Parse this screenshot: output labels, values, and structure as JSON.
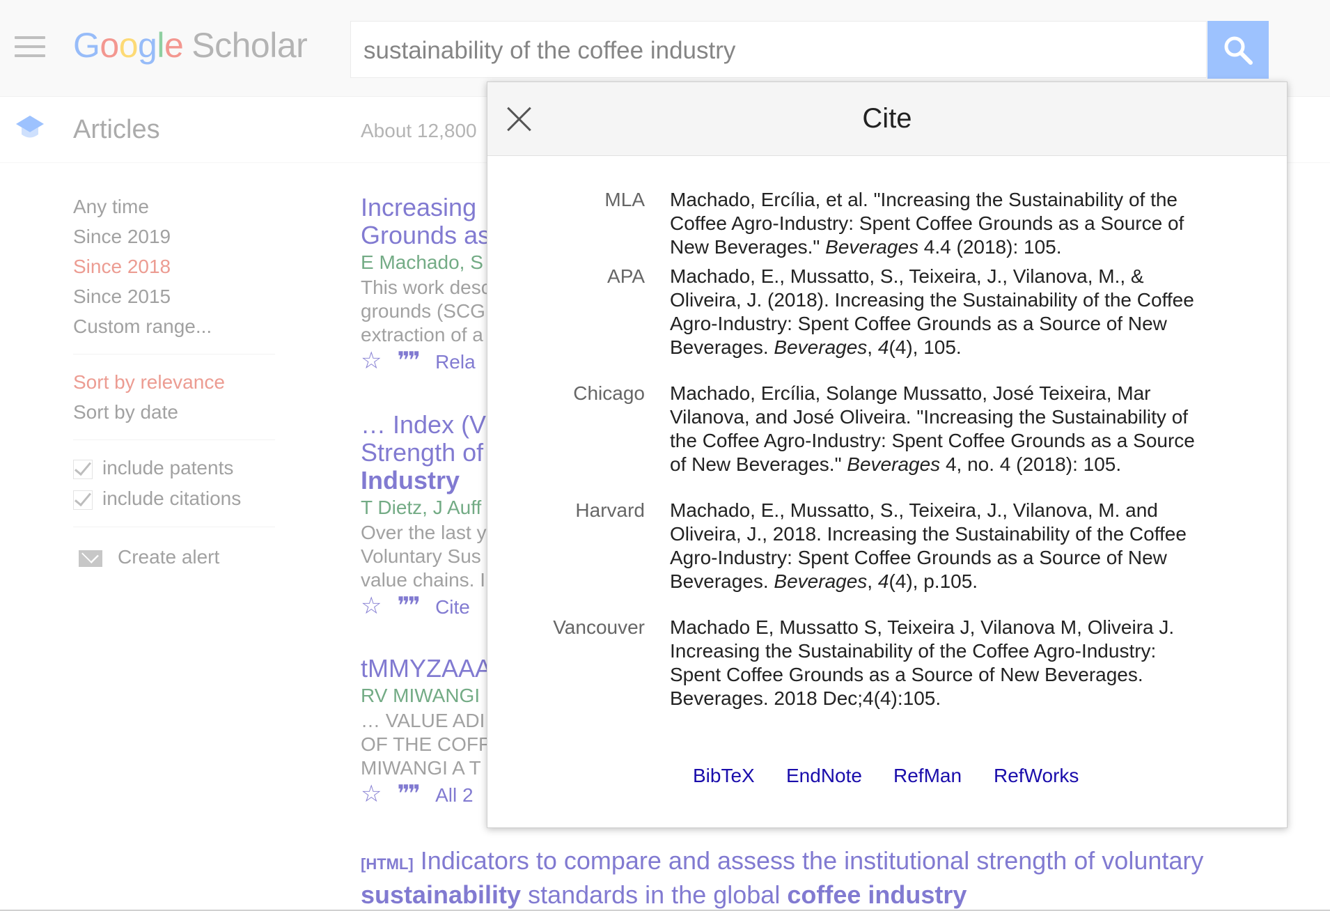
{
  "header": {
    "logo_google": "Google",
    "logo_scholar": "Scholar",
    "search_query": "sustainability of the coffee industry"
  },
  "subbar": {
    "articles_label": "Articles",
    "about_text": "About 12,800"
  },
  "sidebar": {
    "time_filters": [
      "Any time",
      "Since 2019",
      "Since 2018",
      "Since 2015",
      "Custom range..."
    ],
    "selected_time": "Since 2018",
    "sort_options": [
      "Sort by relevance",
      "Sort by date"
    ],
    "selected_sort": "Sort by relevance",
    "include_patents": "include patents",
    "include_citations": "include citations",
    "create_alert": "Create alert"
  },
  "results": [
    {
      "title_lines": [
        "Increasing",
        "Grounds as"
      ],
      "authors": "E Machado, S",
      "snippet_lines": [
        "This work desc",
        "grounds (SCG",
        "extraction of a"
      ],
      "action_link": "Rela"
    },
    {
      "title_lines": [
        "… Index (V",
        "Strength of",
        "Industry"
      ],
      "authors": "T Dietz, J Auff",
      "snippet_lines": [
        "Over the last y",
        "Voluntary Sus",
        "value chains. I"
      ],
      "action_link": "Cite"
    },
    {
      "title_lines": [
        "tMMYZAAA"
      ],
      "authors": "RV MIWANGI",
      "snippet_lines": [
        "… VALUE ADI",
        "OF THE COFF",
        "MIWANGI A T"
      ],
      "action_link": "All 2"
    }
  ],
  "last_result": {
    "tag": "[HTML]",
    "title_part1": "Indicators to compare and assess the institutional strength of voluntary",
    "title_bold1": "sustainability",
    "title_part2": " standards in the global ",
    "title_bold2": "coffee industry"
  },
  "cite_modal": {
    "title": "Cite",
    "citations": [
      {
        "style": "MLA",
        "lines": [
          {
            "pre": "Machado, Ercília, et al. \"Increasing the Sustainability of the",
            "it": "",
            "post": ""
          },
          {
            "pre": "Coffee Agro-Industry: Spent Coffee Grounds as a Source of",
            "it": "",
            "post": ""
          },
          {
            "pre": "New Beverages.\" ",
            "it": "Beverages",
            "post": " 4.4 (2018): 105."
          }
        ]
      },
      {
        "style": "APA",
        "lines": [
          {
            "pre": "Machado, E., Mussatto, S., Teixeira, J., Vilanova, M., &",
            "it": "",
            "post": ""
          },
          {
            "pre": "Oliveira, J. (2018). Increasing the Sustainability of the Coffee",
            "it": "",
            "post": ""
          },
          {
            "pre": "Agro-Industry: Spent Coffee Grounds as a Source of New",
            "it": "",
            "post": ""
          },
          {
            "pre": "Beverages. ",
            "it": "Beverages",
            "post": ", ",
            "it2": "4",
            "post2": "(4), 105."
          }
        ]
      },
      {
        "style": "Chicago",
        "lines": [
          {
            "pre": "Machado, Ercília, Solange Mussatto, José Teixeira, Mar",
            "it": "",
            "post": ""
          },
          {
            "pre": "Vilanova, and José Oliveira. \"Increasing the Sustainability of",
            "it": "",
            "post": ""
          },
          {
            "pre": "the Coffee Agro-Industry: Spent Coffee Grounds as a Source",
            "it": "",
            "post": ""
          },
          {
            "pre": "of New Beverages.\" ",
            "it": "Beverages",
            "post": " 4, no. 4 (2018): 105."
          }
        ]
      },
      {
        "style": "Harvard",
        "lines": [
          {
            "pre": "Machado, E., Mussatto, S., Teixeira, J., Vilanova, M. and",
            "it": "",
            "post": ""
          },
          {
            "pre": "Oliveira, J., 2018. Increasing the Sustainability of the Coffee",
            "it": "",
            "post": ""
          },
          {
            "pre": "Agro-Industry: Spent Coffee Grounds as a Source of New",
            "it": "",
            "post": ""
          },
          {
            "pre": "Beverages. ",
            "it": "Beverages",
            "post": ", ",
            "it2": "4",
            "post2": "(4), p.105."
          }
        ]
      },
      {
        "style": "Vancouver",
        "lines": [
          {
            "pre": "Machado E, Mussatto S, Teixeira J, Vilanova M, Oliveira J.",
            "it": "",
            "post": ""
          },
          {
            "pre": "Increasing the Sustainability of the Coffee Agro-Industry:",
            "it": "",
            "post": ""
          },
          {
            "pre": "Spent Coffee Grounds as a Source of New Beverages.",
            "it": "",
            "post": ""
          },
          {
            "pre": "Beverages. 2018 Dec;4(4):105.",
            "it": "",
            "post": ""
          }
        ]
      }
    ],
    "export_links": [
      "BibTeX",
      "EndNote",
      "RefMan",
      "RefWorks"
    ]
  },
  "colors": {
    "link": "#1a0dab",
    "author_green": "#006621",
    "selected_red": "#dd4b39",
    "search_button": "#4d90fe"
  },
  "icons": [
    "hamburger-menu-icon",
    "search-icon",
    "graduation-cap-icon",
    "checkbox-icon",
    "mail-icon",
    "star-icon",
    "quote-icon",
    "close-icon"
  ]
}
